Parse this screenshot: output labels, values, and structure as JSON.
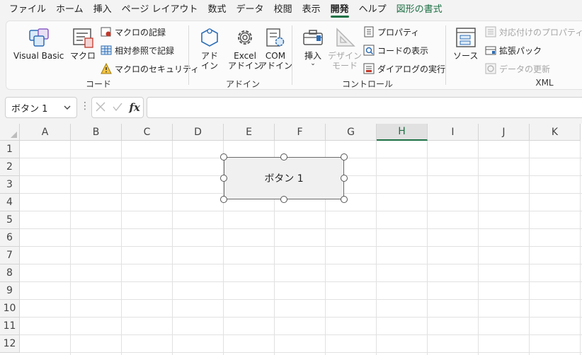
{
  "tabs": [
    {
      "label": "ファイル"
    },
    {
      "label": "ホーム"
    },
    {
      "label": "挿入"
    },
    {
      "label": "ページ レイアウト"
    },
    {
      "label": "数式"
    },
    {
      "label": "データ"
    },
    {
      "label": "校閲"
    },
    {
      "label": "表示"
    },
    {
      "label": "開発",
      "active": true
    },
    {
      "label": "ヘルプ"
    },
    {
      "label": "図形の書式"
    }
  ],
  "ribbon": {
    "code": {
      "label": "コード",
      "visual_basic": "Visual Basic",
      "macro": "マクロ",
      "record_macro": "マクロの記録",
      "relative_ref": "相対参照で記録",
      "macro_security": "マクロのセキュリティ"
    },
    "addins": {
      "label": "アドイン",
      "addin_line1": "アド",
      "addin_line2": "イン",
      "excel_line1": "Excel",
      "excel_line2": "アドイン",
      "com_line1": "COM",
      "com_line2": "アドイン"
    },
    "controls": {
      "label": "コントロール",
      "insert": "挿入",
      "design_line1": "デザイン",
      "design_line2": "モード",
      "properties": "プロパティ",
      "view_code": "コードの表示",
      "run_dialog": "ダイアログの実行"
    },
    "xml": {
      "label": "XML",
      "source": "ソース",
      "map_properties": "対応付けのプロパティ",
      "expansion_packs": "拡張パック",
      "refresh_data": "データの更新"
    }
  },
  "formula_bar": {
    "name_box": "ボタン 1",
    "fx": "fx",
    "formula": ""
  },
  "columns": [
    "A",
    "B",
    "C",
    "D",
    "E",
    "F",
    "G",
    "H",
    "I",
    "J",
    "K"
  ],
  "selected_column": "H",
  "rows": [
    "1",
    "2",
    "3",
    "4",
    "5",
    "6",
    "7",
    "8",
    "9",
    "10",
    "11",
    "12"
  ],
  "form_button": {
    "label": "ボタン 1"
  },
  "colors": {
    "accent": "#1e7145"
  }
}
